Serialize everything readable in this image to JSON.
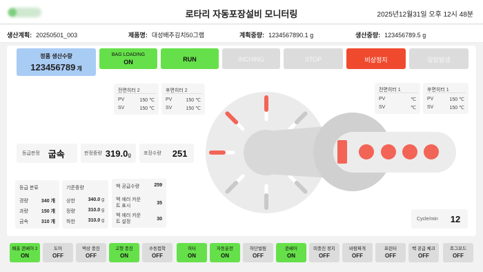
{
  "header": {
    "title": "로타리 자동포장설비 모니터링",
    "datetime": "2025년12월31일 오후 12시 48분"
  },
  "info": {
    "plan_label": "생산계획:",
    "plan_value": "20250501_003",
    "product_label": "제품명:",
    "product_value": "대성배추김치50그램",
    "plan_weight_label": "계획중량:",
    "plan_weight_value": "1234567890.1",
    "plan_weight_unit": "g",
    "prod_weight_label": "생산중량:",
    "prod_weight_value": "123456789.5",
    "prod_weight_unit": "g"
  },
  "production": {
    "label": "정품 생산수량",
    "value": "123456789",
    "unit": "개"
  },
  "controls": [
    {
      "line1": "BAG LOADING",
      "line2": "ON",
      "state": "green"
    },
    {
      "line1": "",
      "line2": "RUN",
      "state": "green"
    },
    {
      "line1": "",
      "line2": "INCHING",
      "state": "gray"
    },
    {
      "line1": "",
      "line2": "STOP",
      "state": "gray"
    },
    {
      "line1": "",
      "line2": "비상정지",
      "state": "red"
    },
    {
      "line1": "",
      "line2": "알람발생",
      "state": "gray"
    }
  ],
  "heaters": {
    "front2": {
      "title": "전면히터 2",
      "pv_label": "PV",
      "pv": "150 ℃",
      "sv_label": "SV",
      "sv": "150 ℃"
    },
    "rear2": {
      "title": "후면히터 2",
      "pv_label": "PV",
      "pv": "150 ℃",
      "sv_label": "SV",
      "sv": "150 ℃"
    },
    "front1": {
      "title": "전면히터 1",
      "pv_label": "PV",
      "pv": "℃",
      "sv_label": "SV",
      "sv": "℃"
    },
    "rear1": {
      "title": "후면히터 1",
      "pv_label": "PV",
      "pv": "150 ℃",
      "sv_label": "SV",
      "sv": "150 ℃"
    }
  },
  "grade": {
    "label": "등급판정",
    "value": "굽속"
  },
  "weight": {
    "label": "판정중량",
    "value": "319.0",
    "unit": "g"
  },
  "pack_count": {
    "label": "포장수량",
    "value": "251"
  },
  "grade_class": {
    "title": "등급 분류",
    "rows": [
      {
        "k": "경량",
        "v": "340 개"
      },
      {
        "k": "과량",
        "v": "150 개"
      },
      {
        "k": "금속",
        "v": "310 개"
      }
    ]
  },
  "ref_weight": {
    "title": "기준중량",
    "rows": [
      {
        "k": "상한",
        "v": "340.0",
        "u": "g"
      },
      {
        "k": "정량",
        "v": "310.0",
        "u": "g"
      },
      {
        "k": "하한",
        "v": "310.0",
        "u": "g"
      }
    ]
  },
  "bag_stats": {
    "rows": [
      {
        "k": "백 공급수량",
        "v": "259"
      },
      {
        "k": "백 에러 카운트 표시",
        "v": "35"
      },
      {
        "k": "백 에러 카운트 설정",
        "v": "30"
      }
    ]
  },
  "cycle": {
    "label": "Cycle/min",
    "value": "12"
  },
  "colors": {
    "accent_green": "#66e04a",
    "alarm_red": "#f04a2e",
    "count_blue": "#a9ccf5",
    "indicator_red": "#f26456"
  },
  "bottom": [
    {
      "label": "배출 콘베어 2",
      "state": "ON"
    },
    {
      "label": "도어",
      "state": "OFF"
    },
    {
      "label": "액상 충진",
      "state": "OFF"
    },
    {
      "label": "고형 충진",
      "state": "ON"
    },
    {
      "label": "수동접착",
      "state": "OFF"
    },
    {
      "label": "히터",
      "state": "ON"
    },
    {
      "label": "자동운전",
      "state": "ON"
    },
    {
      "label": "하단벌림",
      "state": "OFF"
    },
    {
      "label": "콘베어",
      "state": "ON"
    },
    {
      "label": "미충진 정지",
      "state": "OFF"
    },
    {
      "label": "바람짜개",
      "state": "OFF"
    },
    {
      "label": "프린터",
      "state": "OFF"
    },
    {
      "label": "백 공급 체크",
      "state": "OFF"
    },
    {
      "label": "조그모드",
      "state": "OFF"
    }
  ]
}
